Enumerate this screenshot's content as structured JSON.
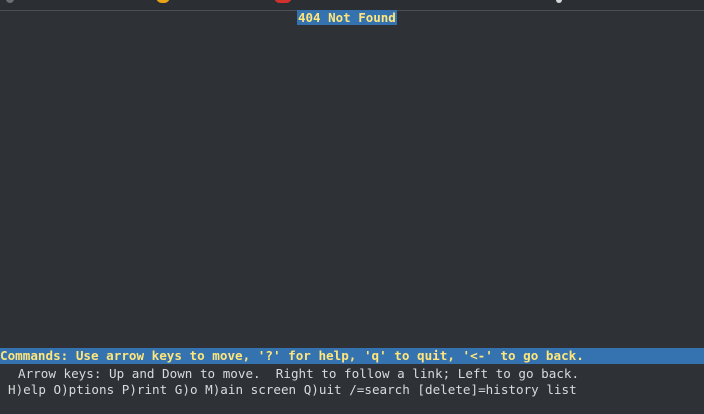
{
  "page": {
    "title": "404 Not Found"
  },
  "status_bar": {
    "commands": "Commands: Use arrow keys to move, '?' for help, 'q' to quit, '<-' to go back."
  },
  "help": {
    "line1": "Arrow keys: Up and Down to move.  Right to follow a link; Left to go back.",
    "line2": "H)elp O)ptions P)rint G)o M)ain screen Q)uit /=search [delete]=history list"
  },
  "colors": {
    "background": "#2e3236",
    "highlight_bg": "#3572b0",
    "highlight_text": "#ffe57a",
    "text": "#d8dadc"
  }
}
